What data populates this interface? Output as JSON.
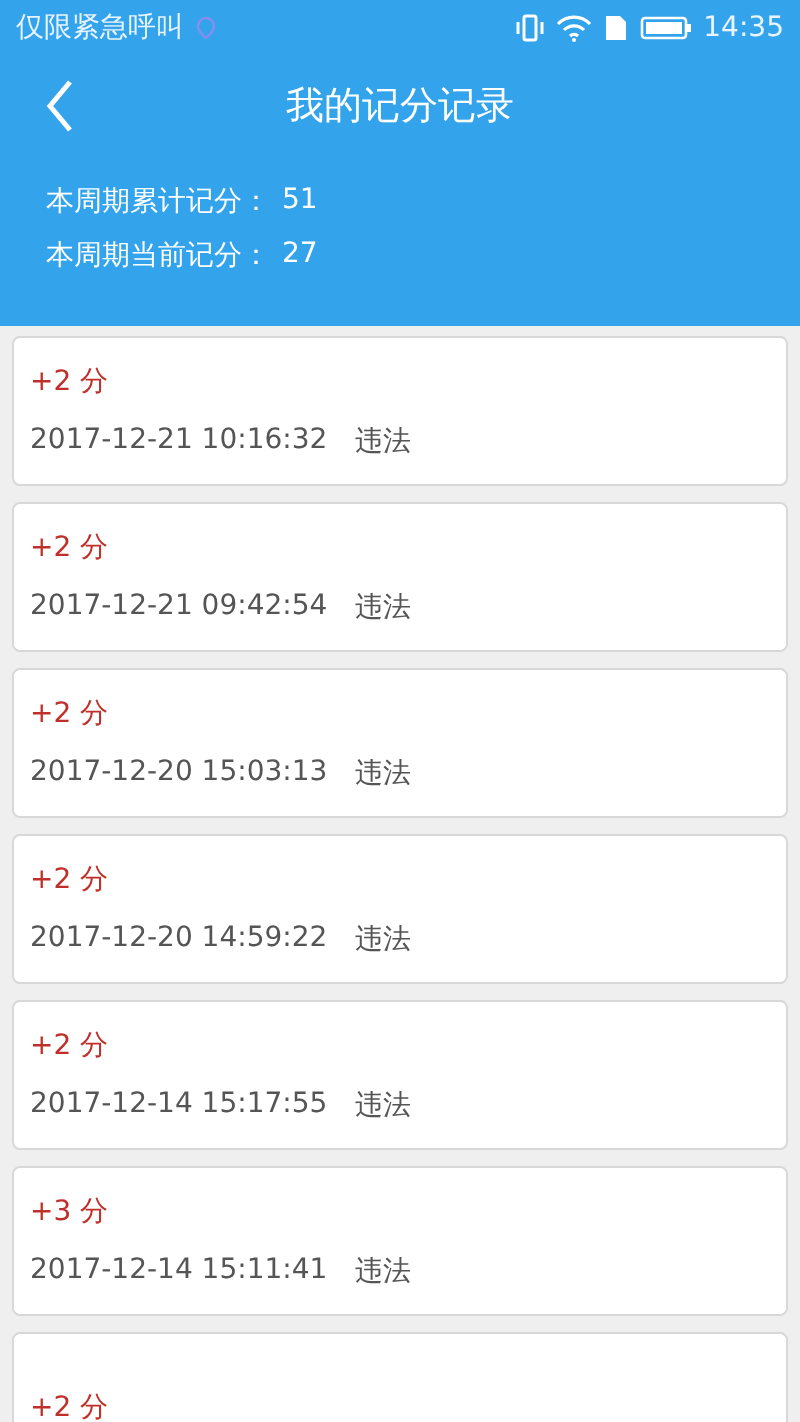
{
  "status_bar": {
    "carrier": "仅限紧急呼叫",
    "time": "14:35"
  },
  "header": {
    "title": "我的记分记录"
  },
  "summary": [
    {
      "label": "本周期累计记分：",
      "value": "51"
    },
    {
      "label": "本周期当前记分：",
      "value": "27"
    }
  ],
  "records": [
    {
      "points": "+2 分",
      "time": "2017-12-21 10:16:32",
      "reason": "违法"
    },
    {
      "points": "+2 分",
      "time": "2017-12-21 09:42:54",
      "reason": "违法"
    },
    {
      "points": "+2 分",
      "time": "2017-12-20 15:03:13",
      "reason": "违法"
    },
    {
      "points": "+2 分",
      "time": "2017-12-20 14:59:22",
      "reason": "违法"
    },
    {
      "points": "+2 分",
      "time": "2017-12-14 15:17:55",
      "reason": "违法"
    },
    {
      "points": "+3 分",
      "time": "2017-12-14 15:11:41",
      "reason": "违法"
    },
    {
      "points": "+2 分"
    }
  ]
}
